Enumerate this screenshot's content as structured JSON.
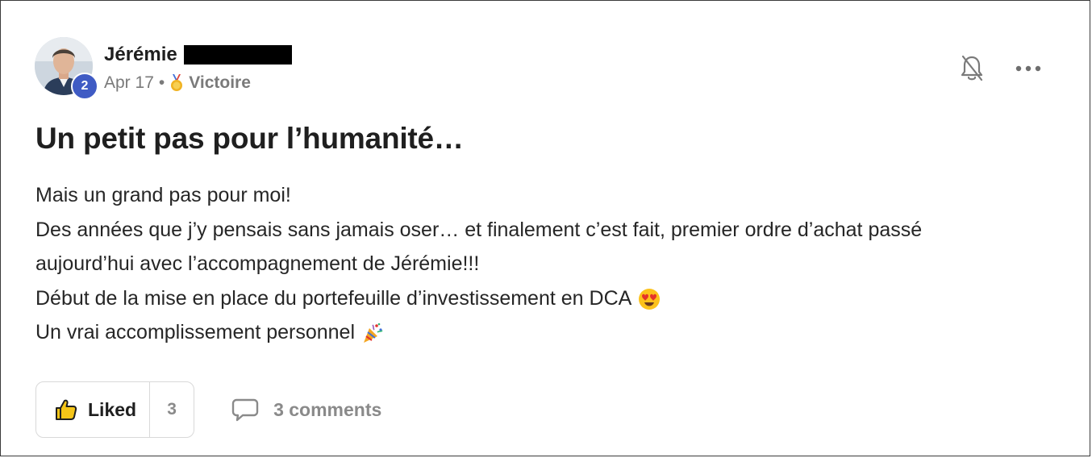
{
  "post": {
    "author_name": "Jérémie",
    "level": "2",
    "date": "Apr 17",
    "separator": "•",
    "category": "Victoire",
    "category_icon": "medal-icon",
    "title": "Un petit pas pour l’humanité…",
    "body_lines": [
      {
        "text": "Mais un grand pas pour moi!",
        "emoji": null
      },
      {
        "text": "Des années que j’y pensais sans jamais oser… et finalement c’est fait, premier ordre d’achat passé",
        "emoji": null
      },
      {
        "text": "aujourd’hui avec l’accompagnement de Jérémie!!!",
        "emoji": null
      },
      {
        "text": "Début de la mise en place du portefeuille d’investissement en DCA",
        "emoji": "heart-eyes-emoji"
      },
      {
        "text": "Un vrai accomplissement personnel",
        "emoji": "party-popper-emoji"
      }
    ]
  },
  "actions": {
    "liked_label": "Liked",
    "like_count": "3",
    "comments_label": "3 comments",
    "notifications_icon": "bell-off-icon",
    "more_icon": "more-horizontal-icon"
  },
  "colors": {
    "badge": "#3f5bc4",
    "muted_text": "#7a7a7a",
    "border": "#d9d9d9"
  }
}
